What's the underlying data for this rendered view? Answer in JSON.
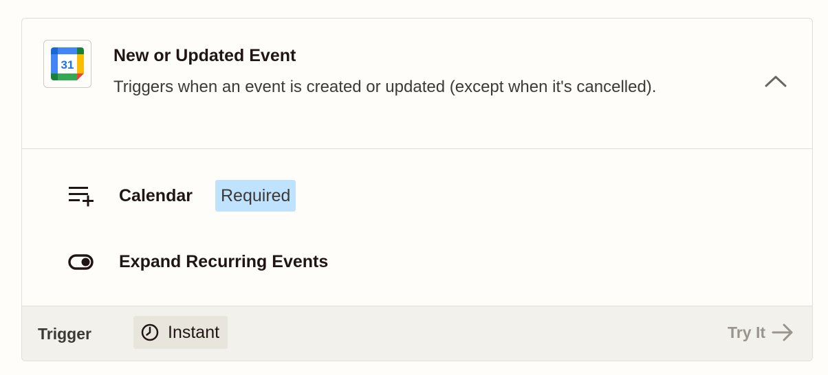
{
  "step": {
    "title": "New or Updated Event",
    "description": "Triggers when an event is created or updated (except when it's cancelled).",
    "app_icon": {
      "name": "google-calendar-icon",
      "day": "31"
    },
    "collapse_icon": "chevron-up-icon"
  },
  "fields": [
    {
      "icon": "add-to-list-icon",
      "label": "Calendar",
      "badge": "Required"
    },
    {
      "icon": "toggle-icon",
      "label": "Expand Recurring Events"
    }
  ],
  "footer": {
    "label": "Trigger",
    "badge_icon": "clock-icon",
    "badge_text": "Instant",
    "action_label": "Try It",
    "action_icon": "arrow-right-icon"
  },
  "colors": {
    "required_badge_bg": "#bfe3ff",
    "footer_bg": "#f3f1ec",
    "instant_badge_bg": "#e8e5dc",
    "try_it_text": "#99948d"
  }
}
